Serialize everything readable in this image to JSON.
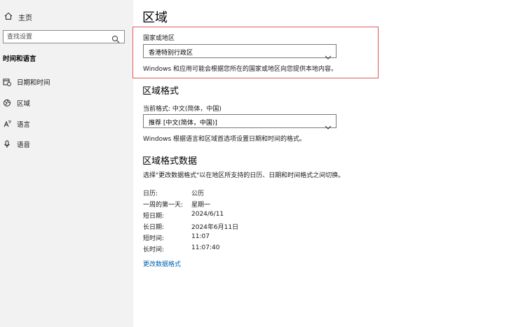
{
  "sidebar": {
    "home_label": "主页",
    "search_placeholder": "查找设置",
    "section_title": "时间和语言",
    "items": [
      {
        "label": "日期和时间",
        "icon": "calendar-clock-icon"
      },
      {
        "label": "区域",
        "icon": "globe-region-icon"
      },
      {
        "label": "语言",
        "icon": "language-icon"
      },
      {
        "label": "语音",
        "icon": "microphone-icon"
      }
    ]
  },
  "main": {
    "title": "区域",
    "country": {
      "label": "国家或地区",
      "value": "香港特别行政区",
      "description": "Windows 和应用可能会根据您所在的国家或地区向您提供本地内容。"
    },
    "format": {
      "heading": "区域格式",
      "current_label": "当前格式: 中文(简体，中国)",
      "value": "推荐 [中文(简体，中国)]",
      "description": "Windows 根据语言和区域首选项设置日期和时间的格式。"
    },
    "format_data": {
      "heading": "区域格式数据",
      "description": "选择\"更改数据格式\"以在地区所支持的日历、日期和时间格式之间切换。",
      "rows": [
        {
          "label": "日历:",
          "value": "公历"
        },
        {
          "label": "一周的第一天:",
          "value": "星期一"
        },
        {
          "label": "短日期:",
          "value": "2024/6/11"
        },
        {
          "label": "长日期:",
          "value": "2024年6月11日"
        },
        {
          "label": "短时间:",
          "value": "11:07"
        },
        {
          "label": "长时间:",
          "value": "11:07:40"
        }
      ],
      "link": "更改数据格式"
    }
  },
  "colors": {
    "sidebar_bg": "#f2f2f2",
    "highlight_border": "#e05a5a",
    "link": "#0063b1"
  }
}
